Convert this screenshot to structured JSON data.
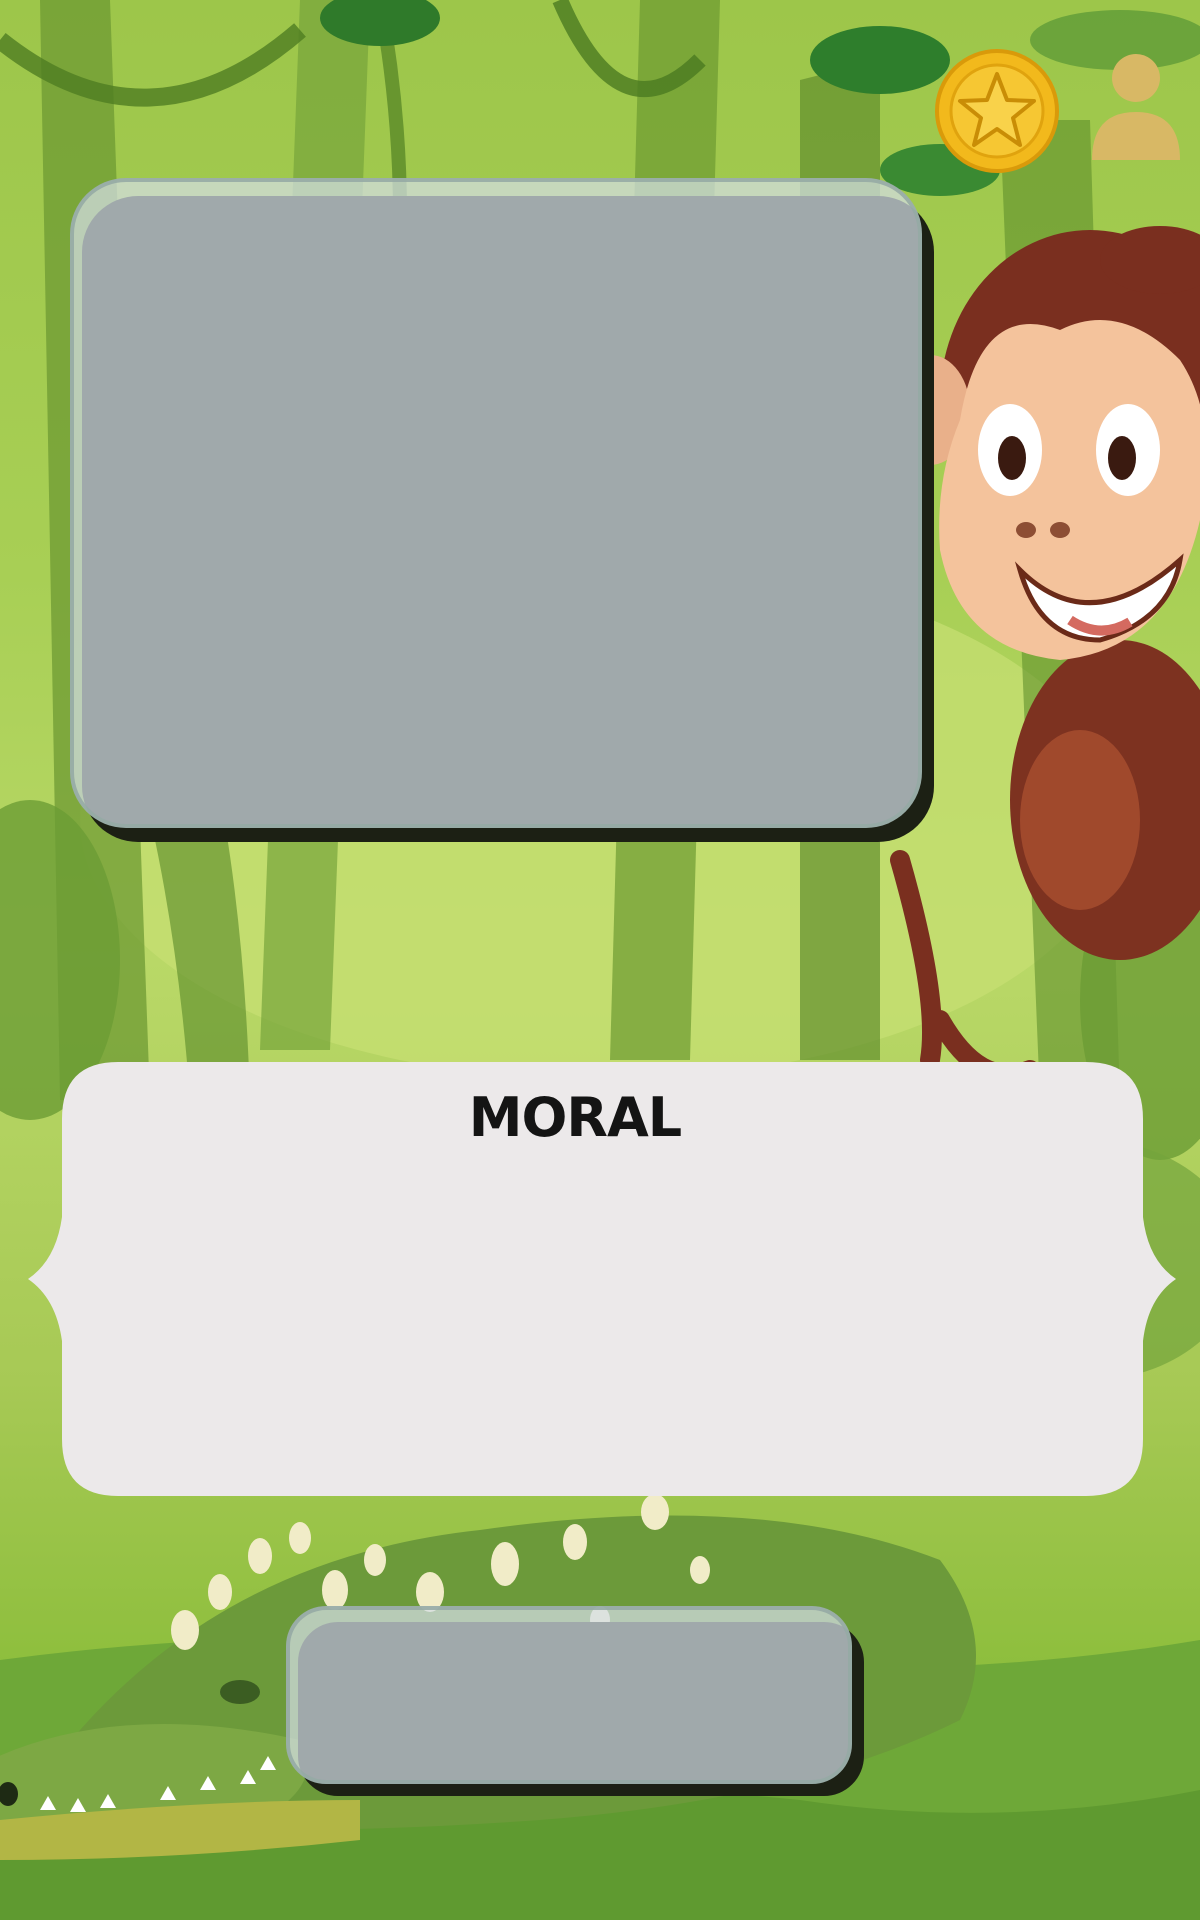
{
  "moral": {
    "title": "MORAL",
    "text": ""
  },
  "icons": {
    "coin": "star-coin-icon",
    "profile": "user-profile-icon"
  },
  "colors": {
    "jungle_light": "#b9d867",
    "jungle_dark": "#5f8f2c",
    "card_background": "#ece9ea",
    "glass_panel": "#d4dee6",
    "coin_gold": "#f2b91c",
    "profile_tan": "#d8b865",
    "monkey_brown": "#7a2f1f"
  }
}
